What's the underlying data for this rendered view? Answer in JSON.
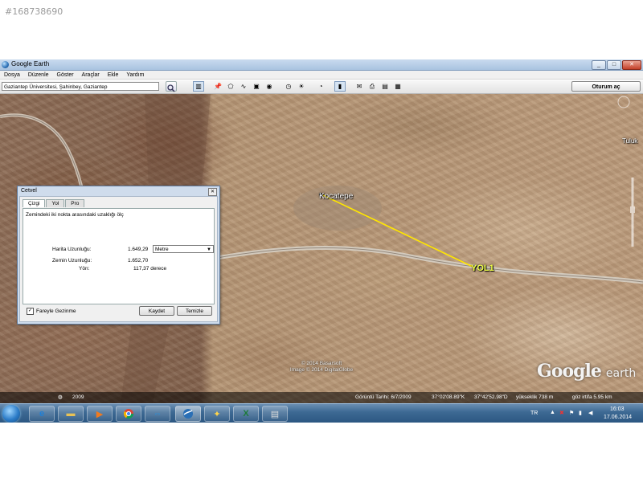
{
  "image_id_label": "#168738690",
  "window": {
    "title": "Google Earth",
    "buttons": [
      "_",
      "□",
      "✕"
    ]
  },
  "menu": [
    "Dosya",
    "Düzenle",
    "Göster",
    "Araçlar",
    "Ekle",
    "Yardım"
  ],
  "toolbar": {
    "search_value": "Gaziantep Üniversitesi, Şahinbey, Gaziantep",
    "signin_label": "Oturum aç"
  },
  "map": {
    "labels": {
      "village": "Kocatepe",
      "road": "YOL1",
      "edge": "Tuluk"
    },
    "copyright_line1": "© 2014 Basarsoft",
    "copyright_line2": "Image © 2014 DigitalGlobe",
    "logo_word1": "Google",
    "logo_word2": "earth",
    "status": {
      "year": "2009",
      "imagery_date": "Görüntü Tarihi: 6/7/2009",
      "lat": "37°02'08.89\"K",
      "lon": "37°42'52.98\"D",
      "elevation": "yükseklik 738 m",
      "eye_alt": "göz irtifa 5.95 km"
    }
  },
  "ruler_dialog": {
    "title": "Cetvel",
    "tabs": [
      "Çizgi",
      "Yol",
      "Pro"
    ],
    "instruction": "Zemindeki iki nokta arasındaki uzaklığı ölç",
    "map_length_label": "Harita Uzunluğu:",
    "map_length_value": "1.649,29",
    "unit": "Metre",
    "ground_length_label": "Zemin Uzunluğu:",
    "ground_length_value": "1.652,70",
    "heading_label": "Yön:",
    "heading_value": "117,37 derece",
    "mouse_nav_label": "Fareyle Gezinme",
    "save_label": "Kaydet",
    "clear_label": "Temizle"
  },
  "taskbar": {
    "lang": "TR",
    "time": "16:03",
    "date": "17.06.2014"
  }
}
